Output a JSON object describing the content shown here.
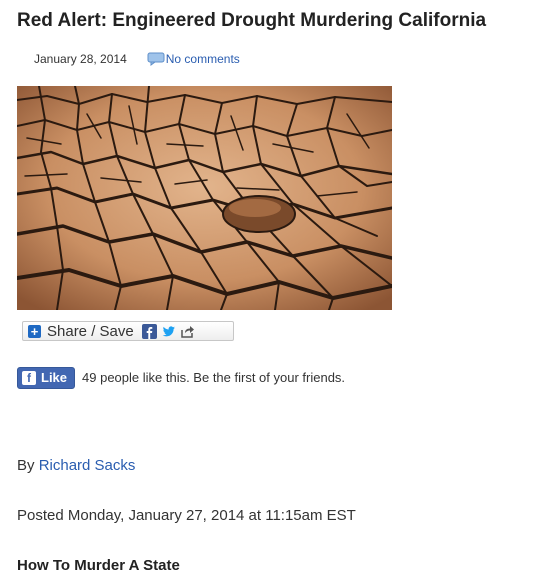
{
  "post": {
    "title": "Red Alert: Engineered Drought Murdering California",
    "date": "January 28, 2014",
    "comments_link": "No comments",
    "image_icon": "cracked-earth-drought-photo"
  },
  "share": {
    "label": "Share / Save",
    "icons": [
      "plus-icon",
      "facebook-icon",
      "twitter-icon",
      "share-arrow-icon"
    ]
  },
  "facebook": {
    "like_label": "Like",
    "like_text": "49 people like this. Be the first of your friends."
  },
  "article": {
    "byline_prefix": "By",
    "author": "Richard Sacks",
    "posted": "Posted Monday, January 27, 2014 at 11:15am EST",
    "subhead": "How To Murder A State"
  },
  "colors": {
    "link": "#2a5db0",
    "facebook": "#4267b2",
    "share_plus": "#1f69c3"
  }
}
